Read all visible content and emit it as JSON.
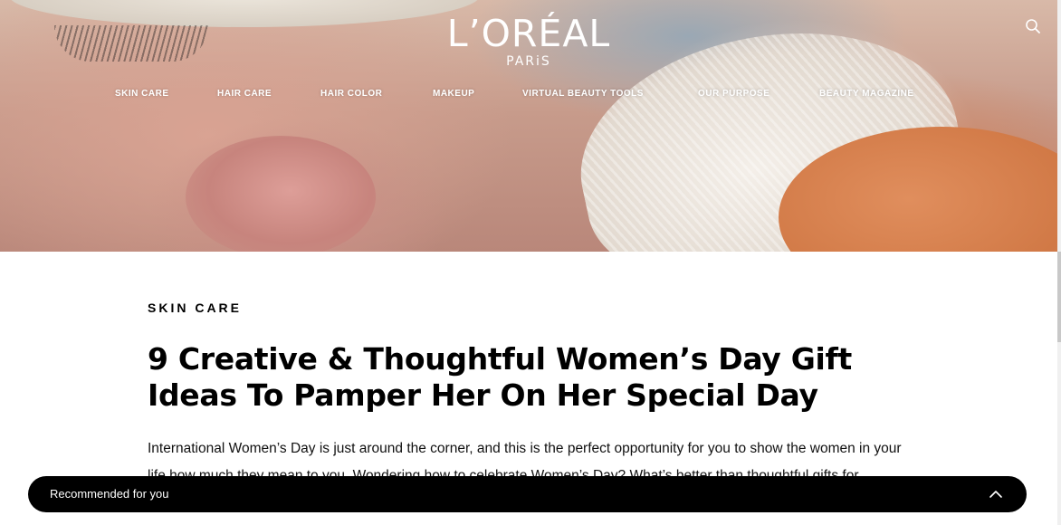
{
  "header": {
    "brand": "L’ORÉAL",
    "brand_sub": "PARiS",
    "nav": [
      {
        "label": "SKIN CARE"
      },
      {
        "label": "HAIR CARE"
      },
      {
        "label": "HAIR COLOR"
      },
      {
        "label": "MAKEUP"
      },
      {
        "label": "VIRTUAL BEAUTY TOOLS"
      },
      {
        "label": "OUR PURPOSE"
      },
      {
        "label": "BEAUTY MAGAZINE"
      }
    ],
    "search_icon": "search-icon"
  },
  "article": {
    "category": "SKIN CARE",
    "title": "9 Creative & Thoughtful Women’s Day Gift Ideas To Pamper Her On Her Special Day",
    "intro": "International Women’s Day is just around the corner, and this is the perfect opportunity for you to show the women in your life how much they mean to you. Wondering how to celebrate Women’s Day? What’s better than thoughtful gifts for Women’s Day this year to fuss, spoil, titivate, delight them and make a lasting and flamboyant"
  },
  "recommended": {
    "label": "Recommended for you",
    "toggle_icon": "chevron-up-icon"
  },
  "colors": {
    "nav_text": "#ffffff",
    "bar_bg": "#000000"
  }
}
